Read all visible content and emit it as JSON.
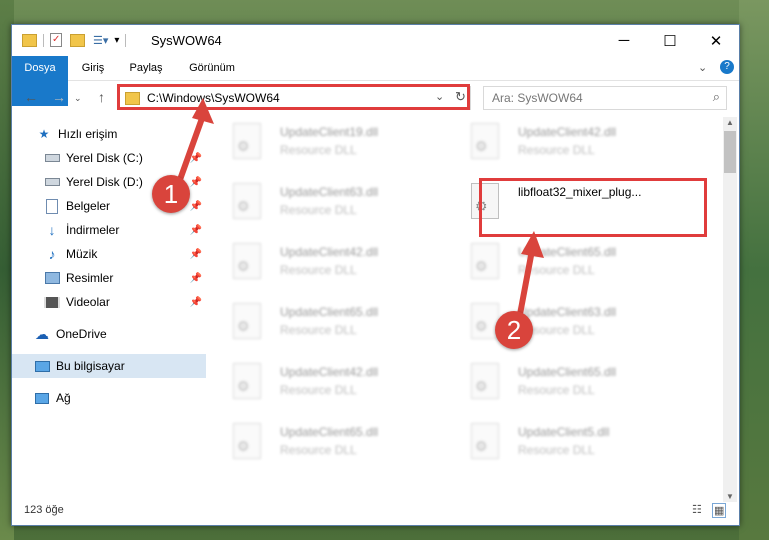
{
  "window": {
    "title": "SysWOW64"
  },
  "ribbon": {
    "tabs": [
      "Dosya",
      "Giriş",
      "Paylaş",
      "Görünüm"
    ]
  },
  "address": {
    "path": "C:\\Windows\\SysWOW64",
    "search_placeholder": "Ara: SysWOW64"
  },
  "sidebar": {
    "quick_access": "Hızlı erişim",
    "items": [
      {
        "label": "Yerel Disk (C:)",
        "icon": "drive-icon"
      },
      {
        "label": "Yerel Disk (D:)",
        "icon": "drive-icon"
      },
      {
        "label": "Belgeler",
        "icon": "documents-icon"
      },
      {
        "label": "İndirmeler",
        "icon": "download-icon"
      },
      {
        "label": "Müzik",
        "icon": "music-icon"
      },
      {
        "label": "Resimler",
        "icon": "pictures-icon"
      },
      {
        "label": "Videolar",
        "icon": "videos-icon"
      }
    ],
    "onedrive": "OneDrive",
    "this_pc": "Bu bilgisayar",
    "network": "Ağ"
  },
  "files": {
    "left": [
      {
        "name": "UpdateClient19.dll",
        "desc": "Resource DLL"
      },
      {
        "name": "UpdateClient63.dll",
        "desc": "Resource DLL"
      },
      {
        "name": "UpdateClient42.dll",
        "desc": "Resource DLL"
      },
      {
        "name": "UpdateClient65.dll",
        "desc": "Resource DLL"
      },
      {
        "name": "UpdateClient42.dll",
        "desc": "Resource DLL"
      },
      {
        "name": "UpdateClient65.dll",
        "desc": "Resource DLL"
      }
    ],
    "right": [
      {
        "name": "UpdateClient42.dll",
        "desc": "Resource DLL"
      },
      {
        "name": "libfloat32_mixer_plug...",
        "desc": ""
      },
      {
        "name": "UpdateClient65.dll",
        "desc": "Resource DLL"
      },
      {
        "name": "UpdateClient63.dll",
        "desc": "Resource DLL"
      },
      {
        "name": "UpdateClient65.dll",
        "desc": "Resource DLL"
      },
      {
        "name": "UpdateClient5.dll",
        "desc": "Resource DLL"
      }
    ]
  },
  "status": {
    "count": "123 öğe"
  },
  "annotations": {
    "step1": "1",
    "step2": "2",
    "color": "#d9443c"
  }
}
